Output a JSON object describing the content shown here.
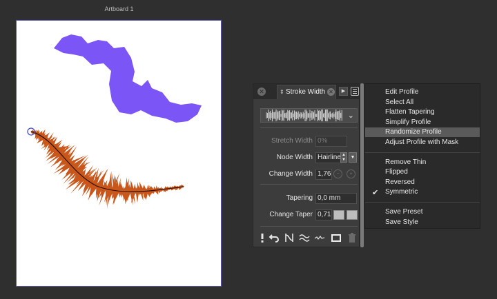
{
  "canvas": {
    "artboard_label": "Artboard 1"
  },
  "stroke_panel": {
    "tab_title": "Stroke Width",
    "stretch_width": {
      "label": "Stretch Width",
      "value": "0%"
    },
    "node_width": {
      "label": "Node Width",
      "value": "Hairline"
    },
    "change_width": {
      "label": "Change Width",
      "value": "1,76"
    },
    "tapering": {
      "label": "Tapering",
      "value": "0,0 mm"
    },
    "change_taper": {
      "label": "Change Taper",
      "value": "0,71"
    }
  },
  "context_menu": {
    "edit_profile": "Edit Profile",
    "select_all": "Select All",
    "flatten_tapering": "Flatten Tapering",
    "simplify_profile": "Simplify Profile",
    "randomize_profile": "Randomize Profile",
    "adjust_profile_mask": "Adjust Profile with Mask",
    "remove_thin": "Remove Thin",
    "flipped": "Flipped",
    "reversed": "Reversed",
    "symmetric": "Symmetric",
    "save_preset": "Save Preset",
    "save_style": "Save Style"
  },
  "colors": {
    "purple_shape": "#7b55f5",
    "orange_brush": "#c9561a",
    "panel_bg": "#3c3c3c",
    "menu_highlight": "#5a5a5a"
  }
}
